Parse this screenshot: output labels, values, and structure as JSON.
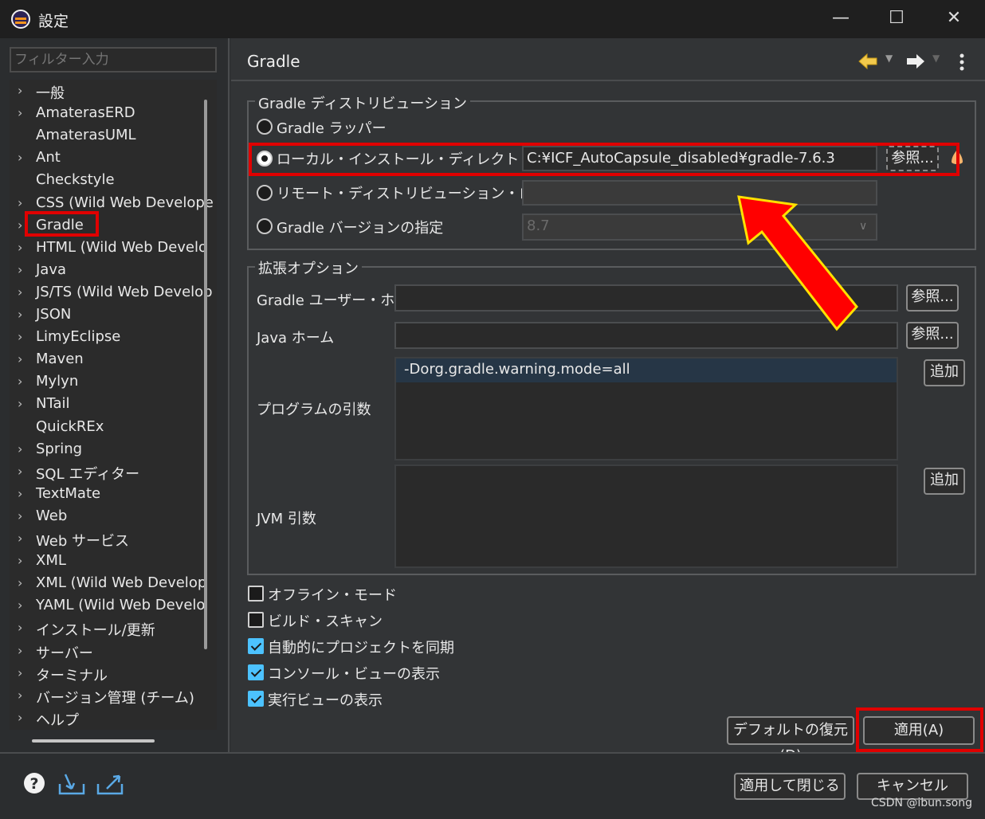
{
  "window": {
    "title": "設定",
    "controls": {
      "minimize": "—",
      "maximize": "☐",
      "close": "✕"
    }
  },
  "sidebar": {
    "filter_placeholder": "フィルター入力",
    "items": [
      {
        "label": "一般",
        "expandable": true
      },
      {
        "label": "AmaterasERD",
        "expandable": true
      },
      {
        "label": "AmaterasUML",
        "expandable": false
      },
      {
        "label": "Ant",
        "expandable": true
      },
      {
        "label": "Checkstyle",
        "expandable": false
      },
      {
        "label": "CSS (Wild Web Develope",
        "expandable": true
      },
      {
        "label": "Gradle",
        "expandable": true,
        "selected": true
      },
      {
        "label": "HTML (Wild Web Develo",
        "expandable": true
      },
      {
        "label": "Java",
        "expandable": true
      },
      {
        "label": "JS/TS (Wild Web Develop",
        "expandable": true
      },
      {
        "label": "JSON",
        "expandable": true
      },
      {
        "label": "LimyEclipse",
        "expandable": true
      },
      {
        "label": "Maven",
        "expandable": true
      },
      {
        "label": "Mylyn",
        "expandable": true
      },
      {
        "label": "NTail",
        "expandable": true
      },
      {
        "label": "QuickREx",
        "expandable": false
      },
      {
        "label": "Spring",
        "expandable": true
      },
      {
        "label": "SQL エディター",
        "expandable": true
      },
      {
        "label": "TextMate",
        "expandable": true
      },
      {
        "label": "Web",
        "expandable": true
      },
      {
        "label": "Web サービス",
        "expandable": true
      },
      {
        "label": "XML",
        "expandable": true
      },
      {
        "label": "XML (Wild Web Develop",
        "expandable": true
      },
      {
        "label": "YAML (Wild Web Develo",
        "expandable": true
      },
      {
        "label": "インストール/更新",
        "expandable": true
      },
      {
        "label": "サーバー",
        "expandable": true
      },
      {
        "label": "ターミナル",
        "expandable": true
      },
      {
        "label": "バージョン管理 (チーム)",
        "expandable": true
      },
      {
        "label": "ヘルプ",
        "expandable": true
      }
    ]
  },
  "main": {
    "title": "Gradle",
    "nav": {
      "back_icon": "arrow-left-icon",
      "forward_icon": "arrow-right-icon",
      "menu_icon": "more-vertical-icon"
    },
    "distribution": {
      "legend": "Gradle ディストリビューション",
      "options": [
        {
          "label": "Gradle ラッパー",
          "selected": false
        },
        {
          "label": "ローカル・インストール・ディレクトリー",
          "selected": true
        },
        {
          "label": "リモート・ディストリビューション・ロケーション",
          "selected": false
        },
        {
          "label": "Gradle バージョンの指定",
          "selected": false
        }
      ],
      "local_dir_value": "C:¥ICF_AutoCapsule_disabled¥gradle-7.6.3",
      "browse_label": "参照...",
      "remote_value": "",
      "version_value": "8.7"
    },
    "advanced": {
      "legend": "拡張オプション",
      "gradle_user_home_label": "Gradle ユーザー・ホーム",
      "gradle_user_home_value": "",
      "java_home_label": "Java ホーム",
      "java_home_value": "",
      "browse_label": "参照...",
      "program_args_label": "プログラムの引数",
      "program_args": [
        "-Dorg.gradle.warning.mode=all"
      ],
      "jvm_args_label": "JVM 引数",
      "add_label": "追加"
    },
    "checkboxes": [
      {
        "label": "オフライン・モード",
        "checked": false
      },
      {
        "label": "ビルド・スキャン",
        "checked": false
      },
      {
        "label": "自動的にプロジェクトを同期",
        "checked": true
      },
      {
        "label": "コンソール・ビューの表示",
        "checked": true
      },
      {
        "label": "実行ビューの表示",
        "checked": true
      }
    ],
    "restore_defaults_label": "デフォルトの復元(D)",
    "apply_label": "適用(A)"
  },
  "footer": {
    "apply_close_label": "適用して閉じる",
    "cancel_label": "キャンセル",
    "watermark": "CSDN @ibun.song"
  },
  "colors": {
    "highlight_red": "#e00000",
    "arrow_yellow": "#ffe100",
    "checkbox_blue": "#4cc2ff"
  }
}
